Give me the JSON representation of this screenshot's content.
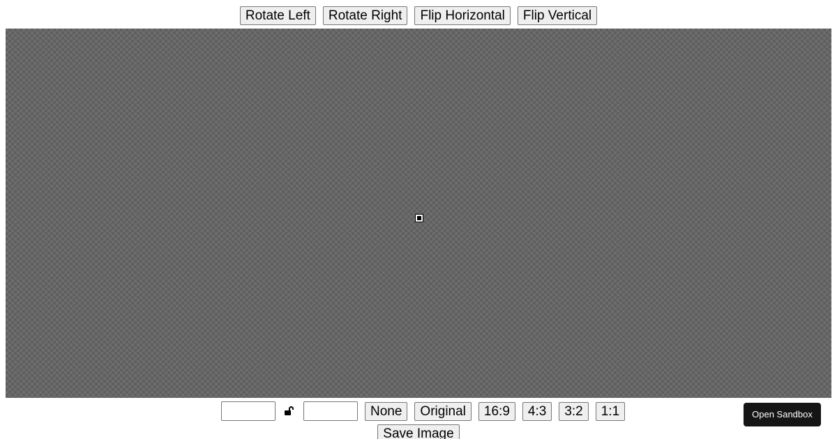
{
  "toolbar": {
    "rotate_left": "Rotate Left",
    "rotate_right": "Rotate Right",
    "flip_horizontal": "Flip Horizontal",
    "flip_vertical": "Flip Vertical"
  },
  "editor": {
    "background_color": "#6d6d6d",
    "checker_color": "#5f5f5f"
  },
  "size": {
    "width_value": "",
    "height_value": "",
    "lock_icon": "unlock-icon"
  },
  "aspect_ratios": {
    "none": "None",
    "original": "Original",
    "r16_9": "16:9",
    "r4_3": "4:3",
    "r3_2": "3:2",
    "r1_1": "1:1"
  },
  "actions": {
    "save_image": "Save Image"
  },
  "sandbox": {
    "label": "Open Sandbox",
    "color": "#151515"
  }
}
